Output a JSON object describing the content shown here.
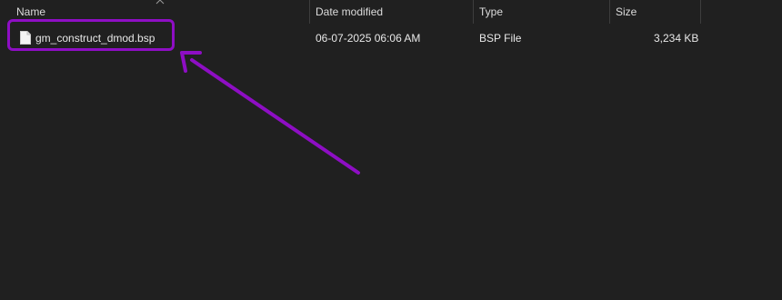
{
  "columns": {
    "name": "Name",
    "date_modified": "Date modified",
    "type": "Type",
    "size": "Size"
  },
  "files": [
    {
      "name": "gm_construct_dmod.bsp",
      "date_modified": "06-07-2025 06:06 AM",
      "type": "BSP File",
      "size": "3,234 KB",
      "icon": "document-icon"
    }
  ],
  "annotation": {
    "color": "#8e0ec4"
  }
}
